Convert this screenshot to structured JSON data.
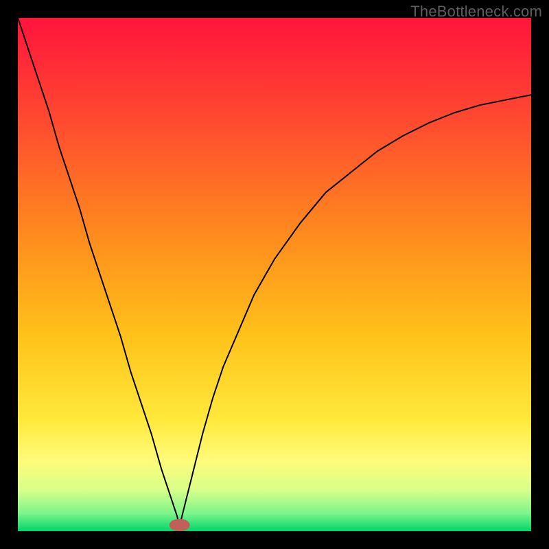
{
  "watermark": "TheBottleneck.com",
  "chart_data": {
    "type": "line",
    "title": "",
    "xlabel": "",
    "ylabel": "",
    "xlim": [
      0,
      100
    ],
    "ylim": [
      0,
      100
    ],
    "legend": false,
    "grid": false,
    "gradient_stops": [
      {
        "offset": 0.0,
        "color": "#ff143c"
      },
      {
        "offset": 0.2,
        "color": "#ff4a30"
      },
      {
        "offset": 0.42,
        "color": "#ff8a1e"
      },
      {
        "offset": 0.62,
        "color": "#ffc21a"
      },
      {
        "offset": 0.78,
        "color": "#ffe83a"
      },
      {
        "offset": 0.86,
        "color": "#fffb78"
      },
      {
        "offset": 0.92,
        "color": "#d8ff8a"
      },
      {
        "offset": 0.965,
        "color": "#7ef58a"
      },
      {
        "offset": 1.0,
        "color": "#00d56a"
      }
    ],
    "marker": {
      "x": 31.5,
      "y": 1.2,
      "rx": 2.0,
      "ry": 1.2,
      "fill": "#c06058"
    },
    "series": [
      {
        "name": "left-curve",
        "x": [
          0,
          2,
          4,
          6,
          8,
          10,
          12,
          14,
          16,
          18,
          20,
          22,
          24,
          26,
          28,
          30,
          31,
          31.5
        ],
        "values": [
          100,
          94,
          88,
          82,
          75,
          69,
          63,
          56,
          50,
          44,
          38,
          31,
          25,
          19,
          12,
          6,
          3,
          1
        ],
        "stroke": "#000000",
        "width": 2
      },
      {
        "name": "right-curve",
        "x": [
          31.5,
          32,
          33,
          34,
          36,
          38,
          40,
          43,
          46,
          50,
          55,
          60,
          65,
          70,
          75,
          80,
          85,
          90,
          95,
          100
        ],
        "values": [
          1,
          3,
          7,
          11,
          19,
          26,
          32,
          39,
          46,
          53,
          60,
          66,
          70,
          74,
          77,
          79.5,
          81.5,
          83,
          84,
          85
        ],
        "stroke": "#000000",
        "width": 2
      }
    ]
  }
}
